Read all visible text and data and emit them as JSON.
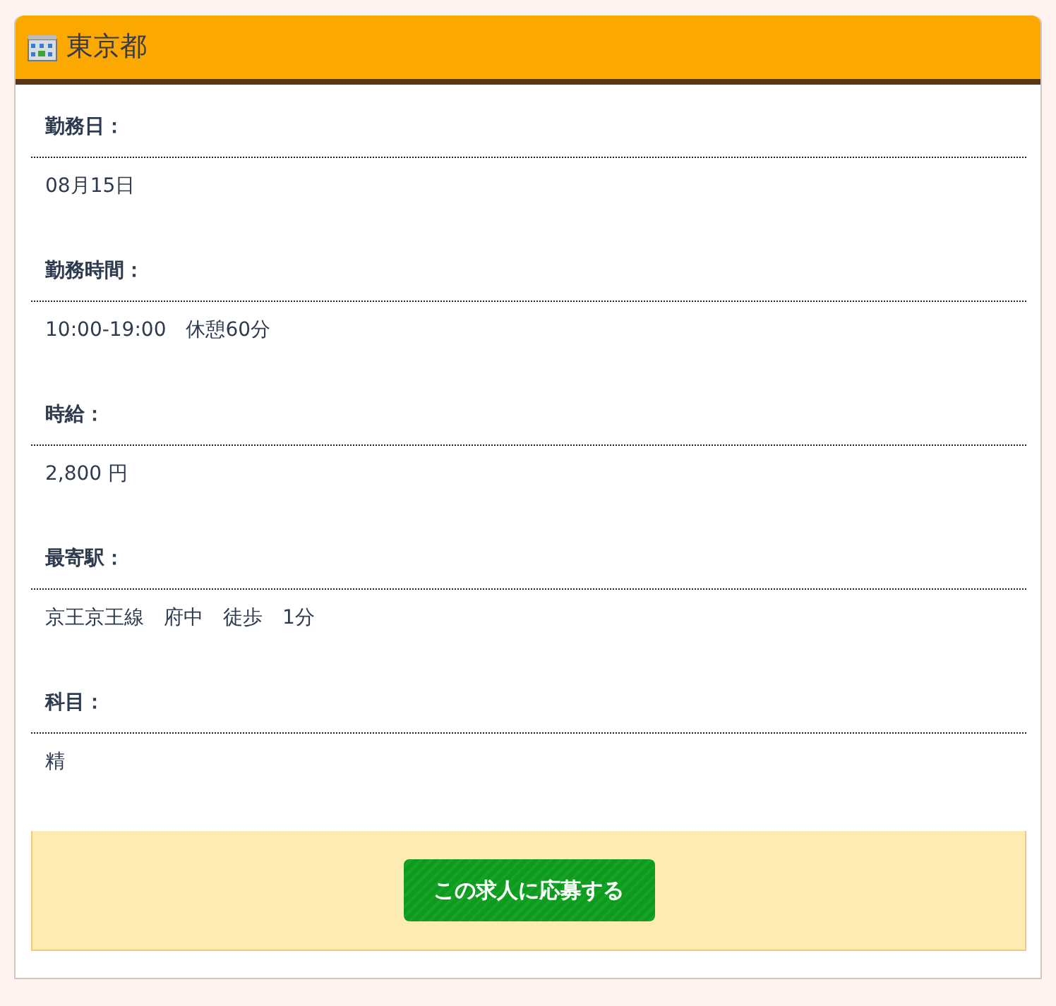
{
  "header": {
    "title": "東京都"
  },
  "fields": [
    {
      "label": "勤務日：",
      "value": "08月15日"
    },
    {
      "label": "勤務時間：",
      "value": "10:00-19:00　休憩60分"
    },
    {
      "label": "時給：",
      "value": "2,800 円"
    },
    {
      "label": "最寄駅：",
      "value": "京王京王線　府中　徒歩　1分"
    },
    {
      "label": "科目：",
      "value": "精"
    }
  ],
  "apply_button": "この求人に応募する"
}
